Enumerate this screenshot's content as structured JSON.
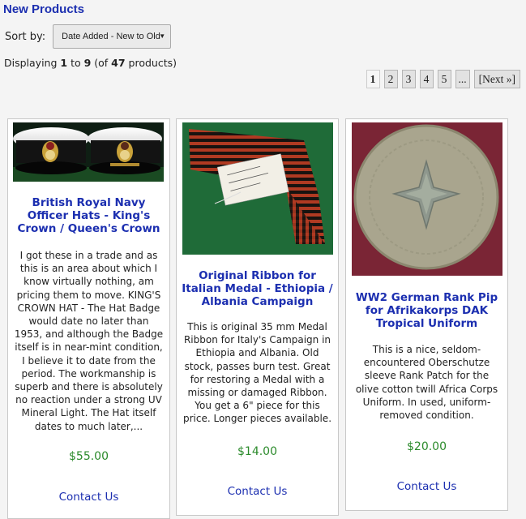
{
  "heading": "New Products",
  "sort": {
    "label": "Sort by:",
    "selected": "Date Added - New to Old"
  },
  "displaying": {
    "prefix": "Displaying ",
    "from": "1",
    "to_word": " to ",
    "to": "9",
    "of_prefix": " (of ",
    "total": "47",
    "suffix": " products)"
  },
  "pagination": {
    "pages": [
      "1",
      "2",
      "3",
      "4",
      "5",
      "..."
    ],
    "next": "[Next »]"
  },
  "products": [
    {
      "title": "British Royal Navy Officer Hats - King's Crown / Queen's Crown",
      "description": "I got these in a trade and as this is an area about which I know virtually nothing, am pricing them to move. KING'S CROWN HAT - The Hat Badge would date no later than 1953, and although the Badge itself is in near-mint condition, I believe it to date from the period. The workmanship is superb and there is absolutely no reaction under a strong UV Mineral Light. The Hat itself dates to much later,...",
      "price": "$55.00",
      "contact": "Contact Us"
    },
    {
      "title": "Original Ribbon for Italian Medal - Ethiopia / Albania Campaign",
      "description": "This is original 35 mm Medal Ribbon for Italy's Campaign in Ethiopia and Albania. Old stock, passes burn test. Great for restoring a Medal with a missing or damaged Ribbon. You get a 6\" piece for this price. Longer pieces available.",
      "price": "$14.00",
      "contact": "Contact Us",
      "image_tag": "Ribbon Italian Campaign in Albania"
    },
    {
      "title": "WW2 German Rank Pip for Afrikakorps DAK Tropical Uniform",
      "description": "This is a nice, seldom-encountered Oberschutze sleeve Rank Patch for the olive cotton twill Africa Corps Uniform. In used, uniform-removed condition.",
      "price": "$20.00",
      "contact": "Contact Us"
    }
  ]
}
